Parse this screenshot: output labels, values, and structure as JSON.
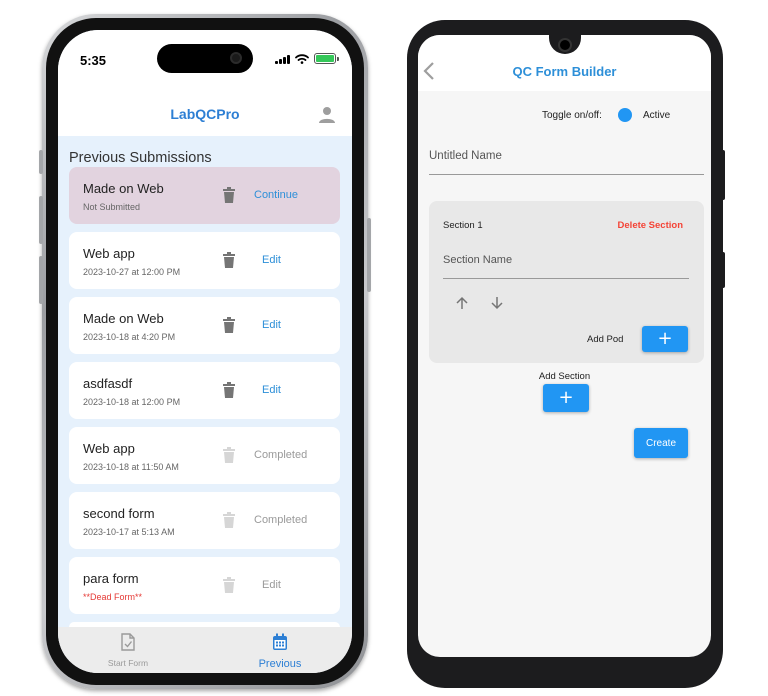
{
  "iphone": {
    "status_time": "5:35",
    "app_title": "LabQCPro",
    "section_title": "Previous Submissions",
    "submissions": [
      {
        "title": "Made on Web",
        "subtitle": "Not Submitted",
        "action": "Continue"
      },
      {
        "title": "Web app",
        "subtitle": "2023-10-27 at 12:00 PM",
        "action": "Edit"
      },
      {
        "title": "Made on Web",
        "subtitle": "2023-10-18 at 4:20 PM",
        "action": "Edit"
      },
      {
        "title": "asdfasdf",
        "subtitle": "2023-10-18 at 12:00 PM",
        "action": "Edit"
      },
      {
        "title": "Web app",
        "subtitle": "2023-10-18 at 11:50 AM",
        "action": "Completed"
      },
      {
        "title": "second form",
        "subtitle": "2023-10-17 at 5:13 AM",
        "action": "Completed"
      },
      {
        "title": "para form",
        "subtitle": "**Dead Form**",
        "action": "Edit"
      }
    ],
    "tabs": {
      "start": "Start Form",
      "previous": "Previous"
    },
    "colors": {
      "accent": "#2d7fd4",
      "highlight_card": "#e2d3df",
      "dead_text": "#e53935",
      "battery": "#34c759"
    }
  },
  "android": {
    "title": "QC Form Builder",
    "toggle_label": "Toggle on/off:",
    "toggle_status": "Active",
    "name_placeholder": "Untitled Name",
    "section": {
      "title": "Section 1",
      "delete_label": "Delete Section",
      "name_placeholder": "Section Name",
      "add_pod_label": "Add Pod"
    },
    "add_section_label": "Add Section",
    "create_label": "Create",
    "colors": {
      "accent": "#2196f3",
      "delete": "#f44336",
      "title": "#2d8fd8"
    }
  }
}
